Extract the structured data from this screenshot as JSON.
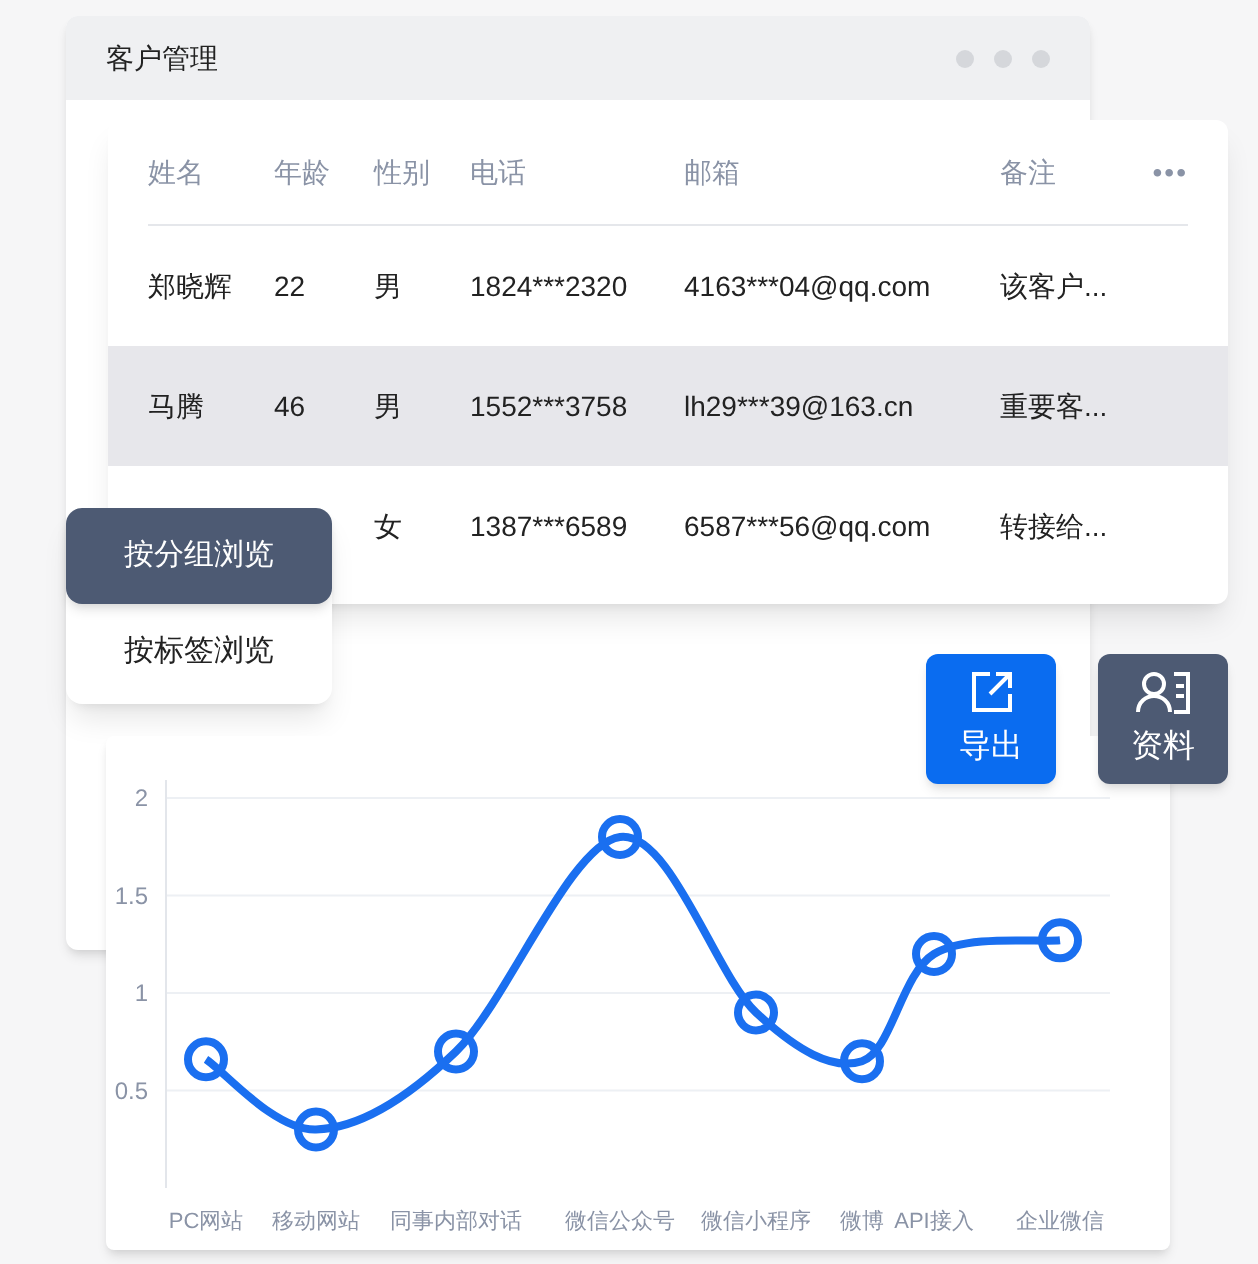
{
  "window": {
    "title": "客户管理"
  },
  "table": {
    "columns": [
      "姓名",
      "年龄",
      "性别",
      "电话",
      "邮箱",
      "备注"
    ],
    "more": "•••",
    "rows": [
      {
        "selected": false,
        "cells": [
          "郑晓辉",
          "22",
          "男",
          "1824***2320",
          "4163***04@qq.com",
          "该客户..."
        ]
      },
      {
        "selected": true,
        "cells": [
          "马腾",
          "46",
          "男",
          "1552***3758",
          "lh29***39@163.cn",
          "重要客..."
        ]
      },
      {
        "selected": false,
        "cells": [
          null,
          null,
          "女",
          "1387***6589",
          "6587***56@qq.com",
          "转接给..."
        ]
      }
    ]
  },
  "browse_menu": [
    {
      "label": "按分组浏览",
      "selected": true
    },
    {
      "label": "按标签浏览",
      "selected": false
    }
  ],
  "actions": [
    {
      "kind": "export",
      "label": "导出"
    },
    {
      "kind": "profile",
      "label": "资料"
    }
  ],
  "chart": {
    "chart_data": {
      "type": "line",
      "categories": [
        "PC网站",
        "移动网站",
        "同事内部对话",
        "微信公众号",
        "微信小程序",
        "微博",
        "API接入",
        "企业微信"
      ],
      "yticks": [
        0.5,
        1,
        1.5,
        2
      ],
      "ylim": [
        0,
        2
      ],
      "grid": true,
      "series": [
        {
          "color": "#1a6ff0",
          "marker": "circle",
          "values": [
            0.66,
            0.3,
            0.7,
            1.8,
            0.9,
            0.65,
            1.2,
            1.27
          ]
        }
      ]
    }
  }
}
